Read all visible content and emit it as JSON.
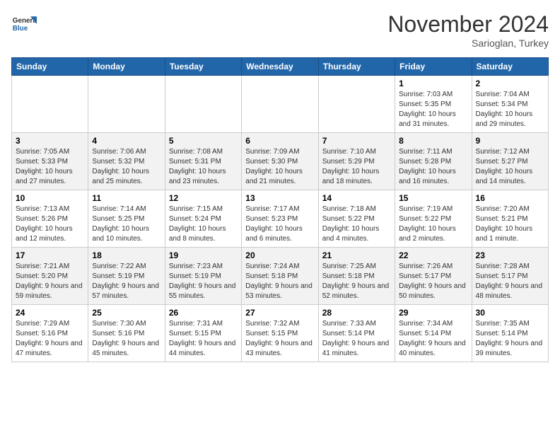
{
  "header": {
    "logo_general": "General",
    "logo_blue": "Blue",
    "month_title": "November 2024",
    "location": "Sarioglan, Turkey"
  },
  "weekdays": [
    "Sunday",
    "Monday",
    "Tuesday",
    "Wednesday",
    "Thursday",
    "Friday",
    "Saturday"
  ],
  "weeks": [
    [
      {
        "day": "",
        "sunrise": "",
        "sunset": "",
        "daylight": ""
      },
      {
        "day": "",
        "sunrise": "",
        "sunset": "",
        "daylight": ""
      },
      {
        "day": "",
        "sunrise": "",
        "sunset": "",
        "daylight": ""
      },
      {
        "day": "",
        "sunrise": "",
        "sunset": "",
        "daylight": ""
      },
      {
        "day": "",
        "sunrise": "",
        "sunset": "",
        "daylight": ""
      },
      {
        "day": "1",
        "sunrise": "Sunrise: 7:03 AM",
        "sunset": "Sunset: 5:35 PM",
        "daylight": "Daylight: 10 hours and 31 minutes."
      },
      {
        "day": "2",
        "sunrise": "Sunrise: 7:04 AM",
        "sunset": "Sunset: 5:34 PM",
        "daylight": "Daylight: 10 hours and 29 minutes."
      }
    ],
    [
      {
        "day": "3",
        "sunrise": "Sunrise: 7:05 AM",
        "sunset": "Sunset: 5:33 PM",
        "daylight": "Daylight: 10 hours and 27 minutes."
      },
      {
        "day": "4",
        "sunrise": "Sunrise: 7:06 AM",
        "sunset": "Sunset: 5:32 PM",
        "daylight": "Daylight: 10 hours and 25 minutes."
      },
      {
        "day": "5",
        "sunrise": "Sunrise: 7:08 AM",
        "sunset": "Sunset: 5:31 PM",
        "daylight": "Daylight: 10 hours and 23 minutes."
      },
      {
        "day": "6",
        "sunrise": "Sunrise: 7:09 AM",
        "sunset": "Sunset: 5:30 PM",
        "daylight": "Daylight: 10 hours and 21 minutes."
      },
      {
        "day": "7",
        "sunrise": "Sunrise: 7:10 AM",
        "sunset": "Sunset: 5:29 PM",
        "daylight": "Daylight: 10 hours and 18 minutes."
      },
      {
        "day": "8",
        "sunrise": "Sunrise: 7:11 AM",
        "sunset": "Sunset: 5:28 PM",
        "daylight": "Daylight: 10 hours and 16 minutes."
      },
      {
        "day": "9",
        "sunrise": "Sunrise: 7:12 AM",
        "sunset": "Sunset: 5:27 PM",
        "daylight": "Daylight: 10 hours and 14 minutes."
      }
    ],
    [
      {
        "day": "10",
        "sunrise": "Sunrise: 7:13 AM",
        "sunset": "Sunset: 5:26 PM",
        "daylight": "Daylight: 10 hours and 12 minutes."
      },
      {
        "day": "11",
        "sunrise": "Sunrise: 7:14 AM",
        "sunset": "Sunset: 5:25 PM",
        "daylight": "Daylight: 10 hours and 10 minutes."
      },
      {
        "day": "12",
        "sunrise": "Sunrise: 7:15 AM",
        "sunset": "Sunset: 5:24 PM",
        "daylight": "Daylight: 10 hours and 8 minutes."
      },
      {
        "day": "13",
        "sunrise": "Sunrise: 7:17 AM",
        "sunset": "Sunset: 5:23 PM",
        "daylight": "Daylight: 10 hours and 6 minutes."
      },
      {
        "day": "14",
        "sunrise": "Sunrise: 7:18 AM",
        "sunset": "Sunset: 5:22 PM",
        "daylight": "Daylight: 10 hours and 4 minutes."
      },
      {
        "day": "15",
        "sunrise": "Sunrise: 7:19 AM",
        "sunset": "Sunset: 5:22 PM",
        "daylight": "Daylight: 10 hours and 2 minutes."
      },
      {
        "day": "16",
        "sunrise": "Sunrise: 7:20 AM",
        "sunset": "Sunset: 5:21 PM",
        "daylight": "Daylight: 10 hours and 1 minute."
      }
    ],
    [
      {
        "day": "17",
        "sunrise": "Sunrise: 7:21 AM",
        "sunset": "Sunset: 5:20 PM",
        "daylight": "Daylight: 9 hours and 59 minutes."
      },
      {
        "day": "18",
        "sunrise": "Sunrise: 7:22 AM",
        "sunset": "Sunset: 5:19 PM",
        "daylight": "Daylight: 9 hours and 57 minutes."
      },
      {
        "day": "19",
        "sunrise": "Sunrise: 7:23 AM",
        "sunset": "Sunset: 5:19 PM",
        "daylight": "Daylight: 9 hours and 55 minutes."
      },
      {
        "day": "20",
        "sunrise": "Sunrise: 7:24 AM",
        "sunset": "Sunset: 5:18 PM",
        "daylight": "Daylight: 9 hours and 53 minutes."
      },
      {
        "day": "21",
        "sunrise": "Sunrise: 7:25 AM",
        "sunset": "Sunset: 5:18 PM",
        "daylight": "Daylight: 9 hours and 52 minutes."
      },
      {
        "day": "22",
        "sunrise": "Sunrise: 7:26 AM",
        "sunset": "Sunset: 5:17 PM",
        "daylight": "Daylight: 9 hours and 50 minutes."
      },
      {
        "day": "23",
        "sunrise": "Sunrise: 7:28 AM",
        "sunset": "Sunset: 5:17 PM",
        "daylight": "Daylight: 9 hours and 48 minutes."
      }
    ],
    [
      {
        "day": "24",
        "sunrise": "Sunrise: 7:29 AM",
        "sunset": "Sunset: 5:16 PM",
        "daylight": "Daylight: 9 hours and 47 minutes."
      },
      {
        "day": "25",
        "sunrise": "Sunrise: 7:30 AM",
        "sunset": "Sunset: 5:16 PM",
        "daylight": "Daylight: 9 hours and 45 minutes."
      },
      {
        "day": "26",
        "sunrise": "Sunrise: 7:31 AM",
        "sunset": "Sunset: 5:15 PM",
        "daylight": "Daylight: 9 hours and 44 minutes."
      },
      {
        "day": "27",
        "sunrise": "Sunrise: 7:32 AM",
        "sunset": "Sunset: 5:15 PM",
        "daylight": "Daylight: 9 hours and 43 minutes."
      },
      {
        "day": "28",
        "sunrise": "Sunrise: 7:33 AM",
        "sunset": "Sunset: 5:14 PM",
        "daylight": "Daylight: 9 hours and 41 minutes."
      },
      {
        "day": "29",
        "sunrise": "Sunrise: 7:34 AM",
        "sunset": "Sunset: 5:14 PM",
        "daylight": "Daylight: 9 hours and 40 minutes."
      },
      {
        "day": "30",
        "sunrise": "Sunrise: 7:35 AM",
        "sunset": "Sunset: 5:14 PM",
        "daylight": "Daylight: 9 hours and 39 minutes."
      }
    ]
  ]
}
